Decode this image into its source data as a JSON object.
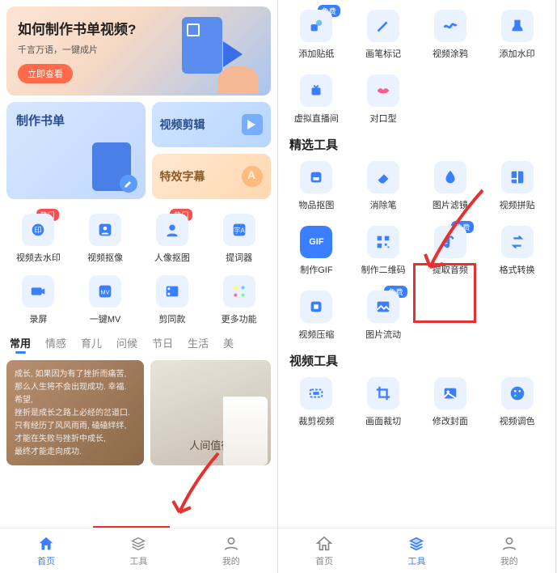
{
  "left": {
    "banner": {
      "title": "如何制作书单视频?",
      "subtitle": "千言万语，一键成片",
      "cta": "立即查看"
    },
    "cards": {
      "big": "制作书单",
      "small1": "视频剪辑",
      "small2": "特效字幕"
    },
    "tools_row1": [
      "视频去水印",
      "视频抠像",
      "人像抠图",
      "提词器"
    ],
    "tools_row2": [
      "录屏",
      "一键MV",
      "剪同款",
      "更多功能"
    ],
    "badge_hot": "热门",
    "tabs": [
      "常用",
      "情感",
      "育儿",
      "问候",
      "节日",
      "生活",
      "美"
    ],
    "content1_lines": [
      "成长, 如果因为有了挫折而痛苦,",
      "那么人生将不会出现成功. 幸福. 希望,",
      "挫折是成长之路上必经的岔道口.",
      "只有经历了风风雨雨, 磕磕绊绊,",
      "才能在失败与挫折中成长,",
      "最终才能走向成功."
    ],
    "content2_text": "人间值得",
    "nav": [
      "首页",
      "工具",
      "我的"
    ]
  },
  "right": {
    "badge_free": "免费",
    "top_tools": [
      "添加贴纸",
      "画笔标记",
      "视频涂鸦",
      "添加水印"
    ],
    "top_tools2": [
      "虚拟直播间",
      "对口型"
    ],
    "section1_title": "精选工具",
    "section1_tools_r1": [
      "物品抠图",
      "消除笔",
      "图片滤镜",
      "视频拼贴"
    ],
    "section1_tools_r2": [
      "制作GIF",
      "制作二维码",
      "提取音频",
      "格式转换"
    ],
    "section1_tools_r3": [
      "视频压缩",
      "图片流动"
    ],
    "section2_title": "视频工具",
    "section2_tools": [
      "裁剪视频",
      "画面裁切",
      "修改封面",
      "视频调色"
    ],
    "nav": [
      "首页",
      "工具",
      "我的"
    ]
  }
}
